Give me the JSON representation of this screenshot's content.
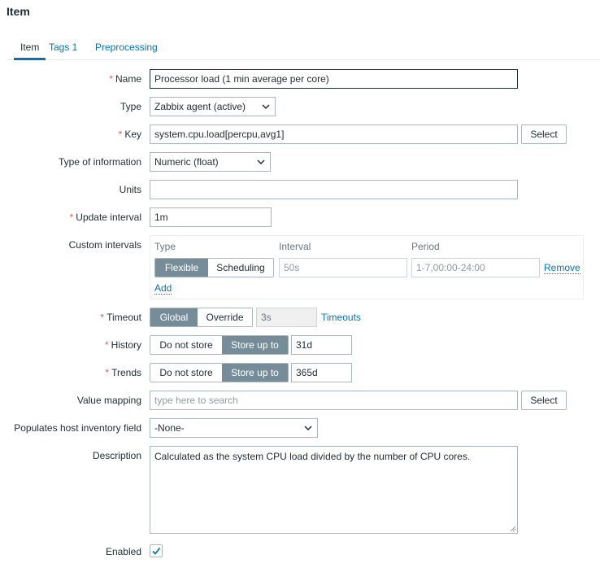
{
  "page": {
    "title": "Item"
  },
  "tabs": [
    {
      "label": "Item"
    },
    {
      "label": "Tags 1"
    },
    {
      "label": "Preprocessing"
    }
  ],
  "form": {
    "name": {
      "label": "Name",
      "value": "Processor load (1 min average per core)"
    },
    "type": {
      "label": "Type",
      "value": "Zabbix agent (active)"
    },
    "key": {
      "label": "Key",
      "value": "system.cpu.load[percpu,avg1]",
      "select_label": "Select"
    },
    "type_of_information": {
      "label": "Type of information",
      "value": "Numeric (float)"
    },
    "units": {
      "label": "Units",
      "value": ""
    },
    "update_interval": {
      "label": "Update interval",
      "value": "1m"
    },
    "custom_intervals": {
      "label": "Custom intervals",
      "col_type": "Type",
      "col_interval": "Interval",
      "col_period": "Period",
      "flexible_label": "Flexible",
      "scheduling_label": "Scheduling",
      "interval_placeholder": "50s",
      "period_placeholder": "1-7,00:00-24:00",
      "remove_label": "Remove",
      "add_label": "Add"
    },
    "timeout": {
      "label": "Timeout",
      "global_label": "Global",
      "override_label": "Override",
      "value": "3s",
      "link_label": "Timeouts"
    },
    "history": {
      "label": "History",
      "do_not_store_label": "Do not store",
      "store_up_to_label": "Store up to",
      "value": "31d"
    },
    "trends": {
      "label": "Trends",
      "do_not_store_label": "Do not store",
      "store_up_to_label": "Store up to",
      "value": "365d"
    },
    "value_mapping": {
      "label": "Value mapping",
      "placeholder": "type here to search",
      "select_label": "Select"
    },
    "inventory": {
      "label": "Populates host inventory field",
      "value": "-None-"
    },
    "description": {
      "label": "Description",
      "value": "Calculated as the system CPU load divided by the number of CPU cores."
    },
    "enabled": {
      "label": "Enabled",
      "checked": true
    }
  },
  "colors": {
    "accent": "#0275b8",
    "segment_active": "#768d99",
    "required": "#e45959"
  }
}
